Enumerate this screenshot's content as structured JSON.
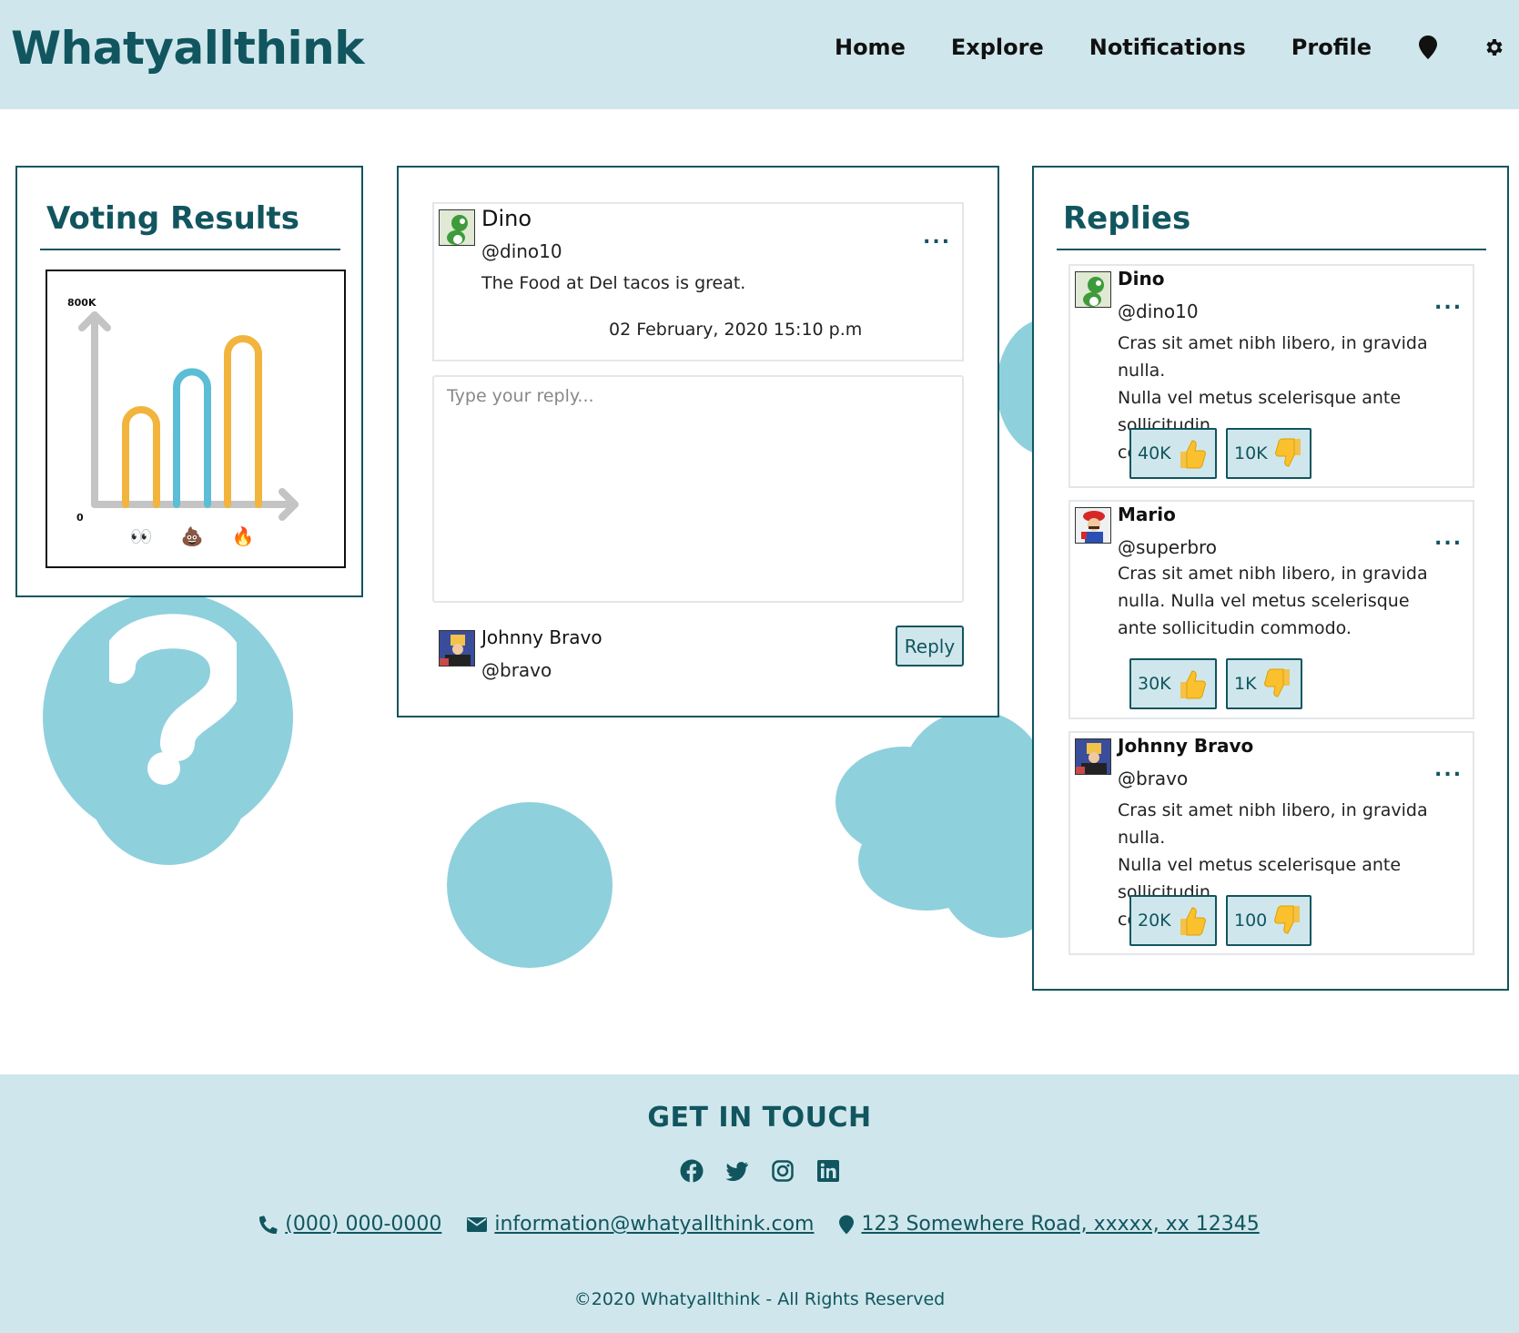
{
  "brand": "Whatyallthink",
  "nav": {
    "items": [
      "Home",
      "Explore",
      "Notifications",
      "Profile"
    ],
    "icons": [
      "map-marker-icon",
      "gear-icon"
    ]
  },
  "voting": {
    "title": "Voting Results",
    "chart_data": {
      "type": "bar",
      "categories": [
        "eyes",
        "poop",
        "fire"
      ],
      "category_icons": [
        "👀",
        "💩",
        "🔥"
      ],
      "values": [
        400000,
        560000,
        700000
      ],
      "colors": [
        "#f2b43c",
        "#5bbdd6",
        "#f2b43c"
      ],
      "ylim": [
        0,
        800000
      ],
      "ytick_labels": [
        "0",
        "800K"
      ],
      "title": "",
      "xlabel": "",
      "ylabel": ""
    }
  },
  "post": {
    "author": "Dino",
    "handle": "@dino10",
    "text": "The Food at Del tacos is great.",
    "timestamp": "02 February, 2020 15:10 p.m",
    "more": "...",
    "reply_placeholder": "Type your reply...",
    "current_user": {
      "name": "Johnny Bravo",
      "handle": "@bravo"
    },
    "reply_button": "Reply"
  },
  "replies": {
    "title": "Replies",
    "items": [
      {
        "name": "Dino",
        "handle": "@dino10",
        "more": "...",
        "lines": [
          "Cras sit amet nibh libero, in gravida nulla.",
          "Nulla vel metus scelerisque ante sollicitudin",
          "commodo."
        ],
        "likes": "40K",
        "dislikes": "10K"
      },
      {
        "name": "Mario",
        "handle": "@superbro",
        "more": "...",
        "lines": [
          "Cras sit amet nibh libero, in gravida",
          "nulla. Nulla vel metus scelerisque",
          "ante sollicitudin commodo."
        ],
        "likes": "30K",
        "dislikes": "1K"
      },
      {
        "name": "Johnny Bravo",
        "handle": "@bravo",
        "more": "...",
        "lines": [
          "Cras sit amet nibh libero, in gravida nulla.",
          "Nulla vel metus scelerisque ante sollicitudin",
          "commodo."
        ],
        "likes": "20K",
        "dislikes": "100"
      }
    ]
  },
  "footer": {
    "title": "GET IN TOUCH",
    "socials": [
      "facebook-icon",
      "twitter-icon",
      "instagram-icon",
      "linkedin-icon"
    ],
    "phone": " (000) 000-0000",
    "email": " information@whatyallthink.com",
    "address": " 123 Somewhere Road, xxxxx, xx 12345",
    "copyright": "©2020 Whatyallthink - All Rights Reserved"
  },
  "colors": {
    "brand": "#11555f",
    "header_bg": "#cfe7ec",
    "blob": "#8fd0dd"
  }
}
